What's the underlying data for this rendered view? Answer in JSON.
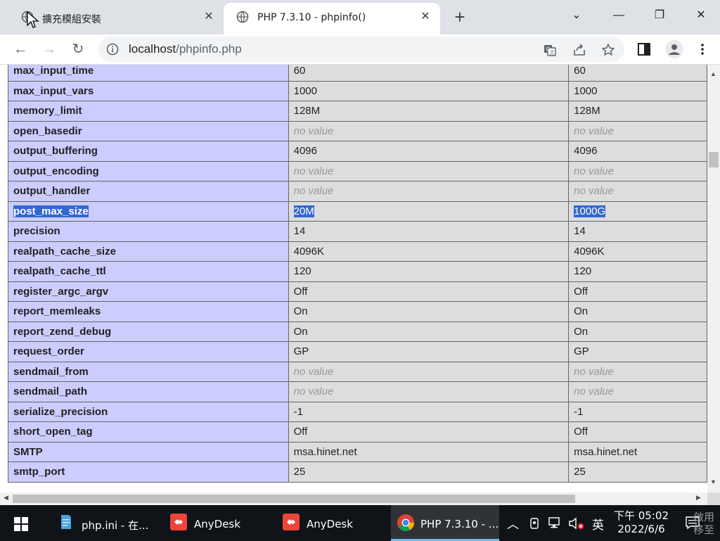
{
  "tabs": [
    {
      "title": "擴充模組安裝",
      "close": "✕"
    },
    {
      "title": "PHP 7.3.10 - phpinfo()",
      "close": "✕"
    }
  ],
  "newtab": "+",
  "window": {
    "dropdown": "⌄",
    "minimize": "—",
    "restore": "❐",
    "close": "✕"
  },
  "toolbar": {
    "back": "←",
    "forward": "→",
    "reload": "↻"
  },
  "address": {
    "host": "localhost",
    "path": "/phpinfo.php"
  },
  "directives": [
    {
      "name": "max_input_time",
      "local": "60",
      "master": "60"
    },
    {
      "name": "max_input_vars",
      "local": "1000",
      "master": "1000"
    },
    {
      "name": "memory_limit",
      "local": "128M",
      "master": "128M"
    },
    {
      "name": "open_basedir",
      "local": "no value",
      "master": "no value",
      "novalue": true
    },
    {
      "name": "output_buffering",
      "local": "4096",
      "master": "4096"
    },
    {
      "name": "output_encoding",
      "local": "no value",
      "master": "no value",
      "novalue": true
    },
    {
      "name": "output_handler",
      "local": "no value",
      "master": "no value",
      "novalue": true
    },
    {
      "name": "post_max_size",
      "local": "20M",
      "master": "1000G",
      "selected": true
    },
    {
      "name": "precision",
      "local": "14",
      "master": "14"
    },
    {
      "name": "realpath_cache_size",
      "local": "4096K",
      "master": "4096K"
    },
    {
      "name": "realpath_cache_ttl",
      "local": "120",
      "master": "120"
    },
    {
      "name": "register_argc_argv",
      "local": "Off",
      "master": "Off"
    },
    {
      "name": "report_memleaks",
      "local": "On",
      "master": "On"
    },
    {
      "name": "report_zend_debug",
      "local": "On",
      "master": "On"
    },
    {
      "name": "request_order",
      "local": "GP",
      "master": "GP"
    },
    {
      "name": "sendmail_from",
      "local": "no value",
      "master": "no value",
      "novalue": true
    },
    {
      "name": "sendmail_path",
      "local": "no value",
      "master": "no value",
      "novalue": true
    },
    {
      "name": "serialize_precision",
      "local": "-1",
      "master": "-1"
    },
    {
      "name": "short_open_tag",
      "local": "Off",
      "master": "Off"
    },
    {
      "name": "SMTP",
      "local": "msa.hinet.net",
      "master": "msa.hinet.net"
    },
    {
      "name": "smtp_port",
      "local": "25",
      "master": "25"
    }
  ],
  "taskbar": {
    "items": [
      {
        "label": "php.ini - 在...",
        "icon": "notepad-icon"
      },
      {
        "label": "AnyDesk",
        "icon": "anydesk-icon"
      },
      {
        "label": "AnyDesk",
        "icon": "anydesk-icon"
      },
      {
        "label": "PHP 7.3.10 - ...",
        "icon": "chrome-icon"
      }
    ],
    "tray_ime": "英",
    "time": "下午 05:02",
    "date": "2022/6/6",
    "watermark_line1": "啟用",
    "watermark_line2": "移至"
  },
  "colors": {
    "header_cell": "#ccccff",
    "value_cell": "#dddddd",
    "selection": "#3367d6",
    "taskbar": "#101418"
  }
}
